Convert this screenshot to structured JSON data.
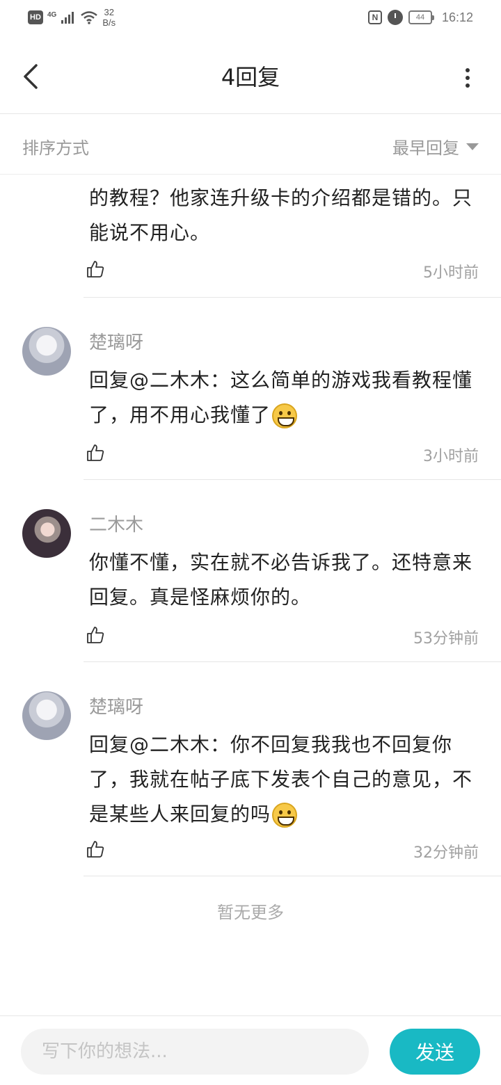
{
  "status_bar": {
    "hd_label": "HD",
    "network_type": "4G",
    "speed_value": "32",
    "speed_unit": "B/s",
    "nfc_label": "N",
    "battery_level": "44",
    "time": "16:12"
  },
  "header": {
    "title": "4回复",
    "back_icon": "chevron-left-icon",
    "more_icon": "more-vertical-icon"
  },
  "sort": {
    "label": "排序方式",
    "value": "最早回复"
  },
  "comments": [
    {
      "username": "",
      "text": "的教程？他家连升级卡的介绍都是错的。只能说不用心。",
      "time": "5小时前",
      "emoji": false
    },
    {
      "username": "楚璃呀",
      "text": "回复@二木木：这么简单的游戏我看教程懂了，用不用心我懂了",
      "time": "3小时前",
      "emoji": true
    },
    {
      "username": "二木木",
      "text": "你懂不懂，实在就不必告诉我了。还特意来回复。真是怪麻烦你的。",
      "time": "53分钟前",
      "emoji": false
    },
    {
      "username": "楚璃呀",
      "text": "回复@二木木：你不回复我我也不回复你了，我就在帖子底下发表个自己的意见，不是某些人来回复的吗",
      "time": "32分钟前",
      "emoji": true
    }
  ],
  "footer_note": "暂无更多",
  "input": {
    "placeholder": "写下你的想法...",
    "value": ""
  },
  "send_label": "发送",
  "colors": {
    "accent": "#19b9c4",
    "secondary_text": "#9a9a9a",
    "divider": "#e6e6e6"
  }
}
